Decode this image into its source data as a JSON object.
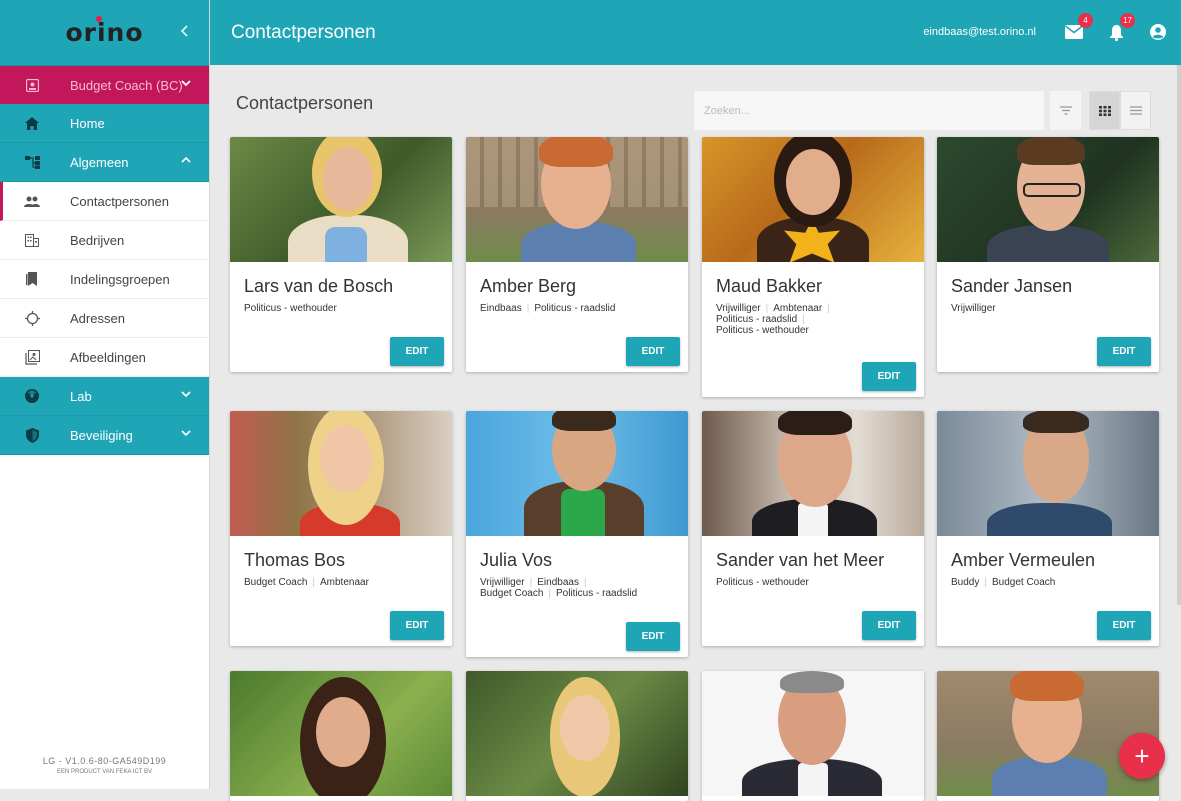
{
  "sidebar": {
    "logo": "orino",
    "collapse_icon": "chevron-left-icon",
    "items": [
      {
        "label": "Budget Coach (BC)",
        "icon": "badge-icon",
        "style": "budget"
      },
      {
        "label": "Home",
        "icon": "home-icon",
        "style": "teal"
      },
      {
        "label": "Algemeen",
        "icon": "sitemap-icon",
        "style": "teal"
      },
      {
        "label": "Contactpersonen",
        "icon": "people-icon",
        "style": "sub-active"
      },
      {
        "label": "Bedrijven",
        "icon": "building-icon",
        "style": "sub"
      },
      {
        "label": "Indelingsgroepen",
        "icon": "bookmark-icon",
        "style": "sub"
      },
      {
        "label": "Adressen",
        "icon": "crosshair-icon",
        "style": "sub"
      },
      {
        "label": "Afbeeldingen",
        "icon": "image-icon",
        "style": "sub"
      },
      {
        "label": "Lab",
        "icon": "radiation-icon",
        "style": "teal"
      },
      {
        "label": "Beveiliging",
        "icon": "shield-icon",
        "style": "teal"
      }
    ],
    "version": "LG - V1.0.6-80-GA549D199",
    "vendor": "EEN PRODUCT VAN FEKA ICT BV"
  },
  "header": {
    "title": "Contactpersonen",
    "email": "eindbaas@test.orino.nl",
    "mail_count": "4",
    "notification_count": "17"
  },
  "main": {
    "title": "Contactpersonen",
    "search_placeholder": "Zoeken...",
    "edit_label": "EDIT",
    "fab_label": "+"
  },
  "cards": [
    {
      "name": "Lars van de Bosch",
      "roles": [
        "Politicus - wethouder"
      ]
    },
    {
      "name": "Amber Berg",
      "roles": [
        "Eindbaas",
        "Politicus - raadslid"
      ]
    },
    {
      "name": "Maud Bakker",
      "roles": [
        "Vrijwilliger",
        "Ambtenaar",
        "Politicus - raadslid",
        "Politicus - wethouder"
      ]
    },
    {
      "name": "Sander Jansen",
      "roles": [
        "Vrijwilliger"
      ]
    },
    {
      "name": "Thomas Bos",
      "roles": [
        "Budget Coach",
        "Ambtenaar"
      ]
    },
    {
      "name": "Julia Vos",
      "roles": [
        "Vrijwilliger",
        "Eindbaas",
        "Budget Coach",
        "Politicus - raadslid"
      ]
    },
    {
      "name": "Sander van het Meer",
      "roles": [
        "Politicus - wethouder"
      ]
    },
    {
      "name": "Amber Vermeulen",
      "roles": [
        "Buddy",
        "Budget Coach"
      ]
    }
  ]
}
